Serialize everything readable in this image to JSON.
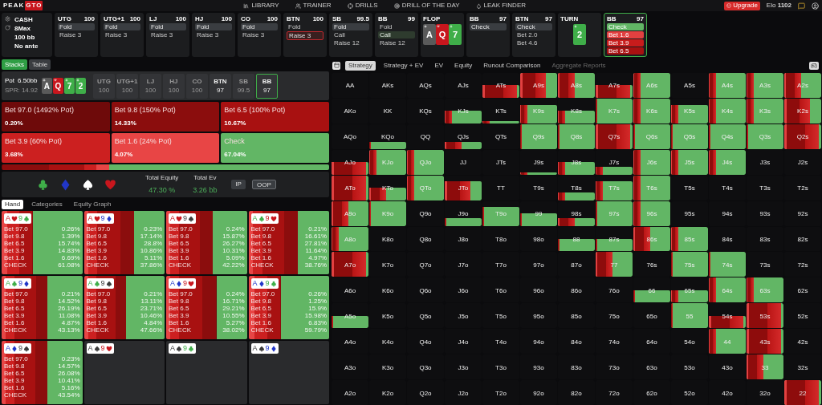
{
  "header": {
    "logo": {
      "part_1": "PEAK",
      "part_2": "GTO"
    },
    "nav": [
      {
        "label": "LIBRARY",
        "kind": "library"
      },
      {
        "label": "TRAINER",
        "kind": "trainer"
      },
      {
        "label": "DRILLS",
        "kind": "drills"
      },
      {
        "label": "DRILL OF THE DAY",
        "kind": "daily"
      },
      {
        "label": "LEAK FINDER",
        "kind": "leak"
      }
    ],
    "upgrade": "Upgrade",
    "elo_label": "Elo",
    "elo": "1102"
  },
  "settings": [
    "CASH",
    "8Max",
    "100 bb",
    "No ante"
  ],
  "nodes": [
    {
      "kind": "seat",
      "position": "UTG",
      "stack": "100",
      "active": false,
      "options": [
        {
          "label": "Fold",
          "kind": "fold",
          "selected": true
        },
        {
          "label": "Raise 3",
          "selected": false
        }
      ]
    },
    {
      "kind": "seat",
      "position": "UTG+1",
      "stack": "100",
      "active": false,
      "options": [
        {
          "label": "Fold",
          "kind": "fold",
          "selected": true
        },
        {
          "label": "Raise 3",
          "selected": false
        }
      ]
    },
    {
      "kind": "seat",
      "position": "LJ",
      "stack": "100",
      "active": false,
      "options": [
        {
          "label": "Fold",
          "kind": "fold",
          "selected": true
        },
        {
          "label": "Raise 3",
          "selected": false
        }
      ]
    },
    {
      "kind": "seat",
      "position": "HJ",
      "stack": "100",
      "active": false,
      "options": [
        {
          "label": "Fold",
          "kind": "fold",
          "selected": true
        },
        {
          "label": "Raise 3",
          "selected": false
        }
      ]
    },
    {
      "kind": "seat",
      "position": "CO",
      "stack": "100",
      "active": false,
      "options": [
        {
          "label": "Fold",
          "kind": "fold",
          "selected": true
        },
        {
          "label": "Raise 3",
          "selected": false
        }
      ]
    },
    {
      "kind": "seat",
      "position": "BTN",
      "stack": "100",
      "active": false,
      "options": [
        {
          "label": "Fold",
          "selected": false
        },
        {
          "label": "Raise 3",
          "kind": "raise",
          "selected": true
        }
      ]
    },
    {
      "kind": "seat",
      "position": "SB",
      "stack": "99.5",
      "active": false,
      "options": [
        {
          "label": "Fold",
          "kind": "fold",
          "selected": true
        },
        {
          "label": "Call",
          "selected": false
        },
        {
          "label": "Raise 12",
          "selected": false
        }
      ]
    },
    {
      "kind": "seat",
      "position": "BB",
      "stack": "99",
      "active": false,
      "options": [
        {
          "label": "Fold",
          "selected": false
        },
        {
          "label": "Call",
          "kind": "call",
          "selected": true
        },
        {
          "label": "Raise 12",
          "selected": false
        }
      ]
    },
    {
      "kind": "board",
      "street": "FLOP",
      "cards": [
        {
          "rank": "A",
          "kind": "spades"
        },
        {
          "rank": "Q",
          "kind": "hearts"
        },
        {
          "rank": "7",
          "kind": "clubs"
        }
      ]
    },
    {
      "kind": "seat",
      "position": "BB",
      "stack": "97",
      "active": false,
      "options": [
        {
          "label": "Check",
          "kind": "check",
          "selected": true
        }
      ]
    },
    {
      "kind": "seat",
      "position": "BTN",
      "stack": "97",
      "active": false,
      "options": [
        {
          "label": "Check",
          "kind": "check",
          "selected": true
        },
        {
          "label": "Bet 2.0",
          "selected": false
        },
        {
          "label": "Bet 4.6",
          "selected": false
        }
      ]
    },
    {
      "kind": "board",
      "street": "TURN",
      "cards": [
        {
          "rank": "2",
          "kind": "clubs"
        }
      ]
    },
    {
      "kind": "seat",
      "position": "BB",
      "stack": "97",
      "active": true,
      "options": [
        {
          "label": "Check",
          "color": "#62b665"
        },
        {
          "label": "Bet 1.6",
          "color": "#e24040"
        },
        {
          "label": "Bet 3.9",
          "color": "#c81c1c"
        },
        {
          "label": "Bet 6.5",
          "color": "#a81111"
        }
      ]
    }
  ],
  "view_tabs": [
    {
      "label": "Stacks",
      "selected": true
    },
    {
      "label": "Table",
      "selected": false
    }
  ],
  "pot": {
    "label": "Pot",
    "value": "6.50bb",
    "spr": "SPR: 14.92",
    "board": [
      {
        "rank": "A",
        "kind": "spades"
      },
      {
        "rank": "Q",
        "kind": "hearts"
      },
      {
        "rank": "7",
        "kind": "clubs"
      },
      {
        "rank": "2",
        "kind": "clubs"
      }
    ],
    "seats": [
      {
        "position": "UTG",
        "stack": "100",
        "folded": true,
        "selected": false
      },
      {
        "position": "UTG+1",
        "stack": "100",
        "folded": true,
        "selected": false
      },
      {
        "position": "LJ",
        "stack": "100",
        "folded": true,
        "selected": false
      },
      {
        "position": "HJ",
        "stack": "100",
        "folded": true,
        "selected": false
      },
      {
        "position": "CO",
        "stack": "100",
        "folded": true,
        "selected": false
      },
      {
        "position": "BTN",
        "stack": "97",
        "folded": false,
        "selected": false
      },
      {
        "position": "SB",
        "stack": "99.5",
        "folded": true,
        "selected": false
      },
      {
        "position": "BB",
        "stack": "97",
        "folded": false,
        "selected": true
      }
    ]
  },
  "actions": [
    {
      "label": "Bet 97.0 (1492% Pot)",
      "frequency": "0.20%",
      "color": "#6e0a0a"
    },
    {
      "label": "Bet 9.8 (150% Pot)",
      "frequency": "14.33%",
      "color": "#8b0d0d"
    },
    {
      "label": "Bet 6.5 (100% Pot)",
      "frequency": "10.67%",
      "color": "#a81111"
    },
    {
      "label": "Bet 3.9 (60% Pot)",
      "frequency": "3.68%",
      "color": "#cc2020"
    },
    {
      "label": "Bet 1.6 (24% Pot)",
      "frequency": "4.07%",
      "color": "#e84545"
    },
    {
      "label": "Check",
      "frequency": "67.04%",
      "color": "#62b665"
    }
  ],
  "suit_filters": [
    {
      "kind": "clubs"
    },
    {
      "kind": "diamonds"
    },
    {
      "kind": "spades"
    },
    {
      "kind": "hearts"
    }
  ],
  "totals": [
    {
      "label": "Total Equity",
      "value": "47.30 %"
    },
    {
      "label": "Total Ev",
      "value": "3.26 bb"
    }
  ],
  "player_buttons": [
    {
      "label": "IP",
      "selected": false
    },
    {
      "label": "OOP",
      "selected": true
    }
  ],
  "hand_tabs": [
    {
      "label": "Hand",
      "selected": true
    },
    {
      "label": "Categories",
      "selected": false
    },
    {
      "label": "Equity Graph",
      "selected": false
    }
  ],
  "hands": [
    {
      "cards": [
        {
          "rank": "A",
          "kind": "hearts"
        },
        {
          "rank": "9",
          "kind": "clubs"
        }
      ],
      "rows": [
        {
          "label": "Bet 97.0",
          "value": "0.26%"
        },
        {
          "label": "Bet 9.8",
          "value": "1.39%"
        },
        {
          "label": "Bet 6.5",
          "value": "15.74%"
        },
        {
          "label": "Bet 3.9",
          "value": "14.83%"
        },
        {
          "label": "Bet 1.6",
          "value": "6.69%"
        },
        {
          "label": "CHECK",
          "value": "61.08%"
        }
      ]
    },
    {
      "cards": [
        {
          "rank": "A",
          "kind": "hearts"
        },
        {
          "rank": "9",
          "kind": "diamonds"
        }
      ],
      "rows": [
        {
          "label": "Bet 97.0",
          "value": "0.23%"
        },
        {
          "label": "Bet 9.8",
          "value": "17.14%"
        },
        {
          "label": "Bet 6.5",
          "value": "28.8%"
        },
        {
          "label": "Bet 3.9",
          "value": "10.86%"
        },
        {
          "label": "Bet 1.6",
          "value": "5.11%"
        },
        {
          "label": "CHECK",
          "value": "37.86%"
        }
      ]
    },
    {
      "cards": [
        {
          "rank": "A",
          "kind": "hearts"
        },
        {
          "rank": "9",
          "kind": "spades"
        }
      ],
      "rows": [
        {
          "label": "Bet 97.0",
          "value": "0.24%"
        },
        {
          "label": "Bet 9.8",
          "value": "15.87%"
        },
        {
          "label": "Bet 6.5",
          "value": "26.27%"
        },
        {
          "label": "Bet 3.9",
          "value": "10.31%"
        },
        {
          "label": "Bet 1.6",
          "value": "5.09%"
        },
        {
          "label": "CHECK",
          "value": "42.22%"
        }
      ]
    },
    {
      "cards": [
        {
          "rank": "A",
          "kind": "clubs"
        },
        {
          "rank": "9",
          "kind": "hearts"
        }
      ],
      "rows": [
        {
          "label": "Bet 97.0",
          "value": "0.21%"
        },
        {
          "label": "Bet 9.8",
          "value": "16.61%"
        },
        {
          "label": "Bet 6.5",
          "value": "27.81%"
        },
        {
          "label": "Bet 3.9",
          "value": "11.64%"
        },
        {
          "label": "Bet 1.6",
          "value": "4.97%"
        },
        {
          "label": "CHECK",
          "value": "38.76%"
        }
      ]
    },
    {
      "cards": [
        {
          "rank": "A",
          "kind": "clubs"
        },
        {
          "rank": "9",
          "kind": "diamonds"
        }
      ],
      "rows": [
        {
          "label": "Bet 97.0",
          "value": "0.21%"
        },
        {
          "label": "Bet 9.8",
          "value": "14.52%"
        },
        {
          "label": "Bet 6.5",
          "value": "26.19%"
        },
        {
          "label": "Bet 3.9",
          "value": "11.08%"
        },
        {
          "label": "Bet 1.6",
          "value": "4.87%"
        },
        {
          "label": "CHECK",
          "value": "43.13%"
        }
      ]
    },
    {
      "cards": [
        {
          "rank": "A",
          "kind": "clubs"
        },
        {
          "rank": "9",
          "kind": "spades"
        }
      ],
      "rows": [
        {
          "label": "Bet 97.0",
          "value": "0.21%"
        },
        {
          "label": "Bet 9.8",
          "value": "13.11%"
        },
        {
          "label": "Bet 6.5",
          "value": "23.71%"
        },
        {
          "label": "Bet 3.9",
          "value": "10.46%"
        },
        {
          "label": "Bet 1.6",
          "value": "4.84%"
        },
        {
          "label": "CHECK",
          "value": "47.66%"
        }
      ]
    },
    {
      "cards": [
        {
          "rank": "A",
          "kind": "diamonds"
        },
        {
          "rank": "9",
          "kind": "hearts"
        }
      ],
      "rows": [
        {
          "label": "Bet 97.0",
          "value": "0.24%"
        },
        {
          "label": "Bet 9.8",
          "value": "16.71%"
        },
        {
          "label": "Bet 6.5",
          "value": "29.21%"
        },
        {
          "label": "Bet 3.9",
          "value": "10.55%"
        },
        {
          "label": "Bet 1.6",
          "value": "5.27%"
        },
        {
          "label": "CHECK",
          "value": "38.02%"
        }
      ]
    },
    {
      "cards": [
        {
          "rank": "A",
          "kind": "diamonds"
        },
        {
          "rank": "9",
          "kind": "clubs"
        }
      ],
      "rows": [
        {
          "label": "Bet 97.0",
          "value": "0.26%"
        },
        {
          "label": "Bet 9.8",
          "value": "1.25%"
        },
        {
          "label": "Bet 6.5",
          "value": "15.9%"
        },
        {
          "label": "Bet 3.9",
          "value": "15.98%"
        },
        {
          "label": "Bet 1.6",
          "value": "6.83%"
        },
        {
          "label": "CHECK",
          "value": "59.79%"
        }
      ]
    },
    {
      "cards": [
        {
          "rank": "A",
          "kind": "diamonds"
        },
        {
          "rank": "9",
          "kind": "spades"
        }
      ],
      "rows": [
        {
          "label": "Bet 97.0",
          "value": "0.23%"
        },
        {
          "label": "Bet 9.8",
          "value": "14.57%"
        },
        {
          "label": "Bet 6.5",
          "value": "26.08%"
        },
        {
          "label": "Bet 3.9",
          "value": "10.41%"
        },
        {
          "label": "Bet 1.6",
          "value": "5.16%"
        },
        {
          "label": "CHECK",
          "value": "43.54%"
        }
      ]
    },
    {
      "cards": [
        {
          "rank": "A",
          "kind": "spades"
        },
        {
          "rank": "9",
          "kind": "hearts"
        }
      ]
    },
    {
      "cards": [
        {
          "rank": "A",
          "kind": "spades"
        },
        {
          "rank": "9",
          "kind": "clubs"
        }
      ]
    },
    {
      "cards": [
        {
          "rank": "A",
          "kind": "spades"
        },
        {
          "rank": "9",
          "kind": "diamonds"
        }
      ]
    }
  ],
  "matrix_tabs": [
    {
      "label": "Strategy",
      "selected": true,
      "disabled": false
    },
    {
      "label": "Strategy + EV",
      "selected": false,
      "disabled": false
    },
    {
      "label": "EV",
      "selected": false,
      "disabled": false
    },
    {
      "label": "Equity",
      "selected": false,
      "disabled": false
    },
    {
      "label": "Runout Comparison",
      "selected": false,
      "disabled": false
    },
    {
      "label": "Aggregate Reports",
      "selected": false,
      "disabled": true
    }
  ],
  "matrix": {
    "rows": [
      {
        "cells": [
          {
            "label": "AA"
          },
          {
            "label": "AKs"
          },
          {
            "label": "AQs"
          },
          {
            "label": "AJs"
          },
          {
            "label": "ATs",
            "kind": "half-red"
          },
          {
            "label": "A9s",
            "kind": "full-heavy"
          },
          {
            "label": "A8s",
            "kind": "full-mixed"
          },
          {
            "label": "A7s",
            "kind": "half-red"
          },
          {
            "label": "A6s",
            "kind": "full-light"
          },
          {
            "label": "A5s"
          },
          {
            "label": "A4s",
            "kind": "full-light"
          },
          {
            "label": "A3s",
            "kind": "full-light"
          },
          {
            "label": "A2s",
            "kind": "full-mixed"
          }
        ]
      },
      {
        "cells": [
          {
            "label": "AKo"
          },
          {
            "label": "KK"
          },
          {
            "label": "KQs"
          },
          {
            "label": "KJs",
            "kind": "half-light"
          },
          {
            "label": "KTs",
            "kind": "thin-light"
          },
          {
            "label": "K9s",
            "kind": "tall-light"
          },
          {
            "label": "K8s",
            "kind": "half-light"
          },
          {
            "label": "K7s",
            "kind": "full-green"
          },
          {
            "label": "K6s",
            "kind": "full-light"
          },
          {
            "label": "K5s",
            "kind": "tall-light"
          },
          {
            "label": "K4s",
            "kind": "full-light"
          },
          {
            "label": "K3s",
            "kind": "full-light"
          },
          {
            "label": "K2s",
            "kind": "full-heavy"
          }
        ]
      },
      {
        "cells": [
          {
            "label": "AQo"
          },
          {
            "label": "KQo",
            "kind": "low-green"
          },
          {
            "label": "QQ"
          },
          {
            "label": "QJs",
            "kind": "low-mixed"
          },
          {
            "label": "QTs"
          },
          {
            "label": "Q9s",
            "kind": "full-green"
          },
          {
            "label": "Q8s",
            "kind": "full-green"
          },
          {
            "label": "Q7s",
            "kind": "full-red"
          },
          {
            "label": "Q6s",
            "kind": "full-green"
          },
          {
            "label": "Q5s",
            "kind": "full-green"
          },
          {
            "label": "Q4s",
            "kind": "full-green"
          },
          {
            "label": "Q3s",
            "kind": "full-green"
          },
          {
            "label": "Q2s",
            "kind": "full-red"
          }
        ]
      },
      {
        "cells": [
          {
            "label": "AJo",
            "kind": "half-red"
          },
          {
            "label": "KJo",
            "kind": "full-light"
          },
          {
            "label": "QJo",
            "kind": "full-light"
          },
          {
            "label": "JJ"
          },
          {
            "label": "JTs"
          },
          {
            "label": "J9s",
            "kind": "thin-light"
          },
          {
            "label": "J8s",
            "kind": "half-light"
          },
          {
            "label": "J7s",
            "kind": "low-light"
          },
          {
            "label": "J6s",
            "kind": "full-light"
          },
          {
            "label": "J5s",
            "kind": "full-light"
          },
          {
            "label": "J4s",
            "kind": "full-light"
          },
          {
            "label": "J3s"
          },
          {
            "label": "J2s"
          }
        ]
      },
      {
        "cells": [
          {
            "label": "ATo",
            "kind": "full-red"
          },
          {
            "label": "KTo",
            "kind": "half-mixed"
          },
          {
            "label": "QTo",
            "kind": "full-light"
          },
          {
            "label": "JTo",
            "kind": "tall-heavy"
          },
          {
            "label": "TT"
          },
          {
            "label": "T9s"
          },
          {
            "label": "T8s",
            "kind": "low-light"
          },
          {
            "label": "T7s",
            "kind": "tall-light"
          },
          {
            "label": "T6s",
            "kind": "full-light"
          },
          {
            "label": "T5s"
          },
          {
            "label": "T4s"
          },
          {
            "label": "T3s"
          },
          {
            "label": "T2s"
          }
        ]
      },
      {
        "cells": [
          {
            "label": "A9o",
            "kind": "full-mixed"
          },
          {
            "label": "K9o",
            "kind": "full-green"
          },
          {
            "label": "Q9o"
          },
          {
            "label": "J9o",
            "kind": "low-green"
          },
          {
            "label": "T9o",
            "kind": "tall-green"
          },
          {
            "label": "99",
            "kind": "half-green"
          },
          {
            "label": "98s",
            "kind": "low-mixed"
          },
          {
            "label": "97s",
            "kind": "full-green"
          },
          {
            "label": "96s",
            "kind": "full-light"
          },
          {
            "label": "95s"
          },
          {
            "label": "94s"
          },
          {
            "label": "93s"
          },
          {
            "label": "92s"
          }
        ]
      },
      {
        "cells": [
          {
            "label": "A8o",
            "kind": "full-light"
          },
          {
            "label": "K8o"
          },
          {
            "label": "Q8o"
          },
          {
            "label": "J8o"
          },
          {
            "label": "T8o"
          },
          {
            "label": "98o"
          },
          {
            "label": "88",
            "kind": "half-green"
          },
          {
            "label": "87s",
            "kind": "half-green"
          },
          {
            "label": "86s",
            "kind": "full-mixed"
          },
          {
            "label": "85s",
            "kind": "full-light"
          },
          {
            "label": "84s"
          },
          {
            "label": "83s"
          },
          {
            "label": "82s"
          }
        ]
      },
      {
        "cells": [
          {
            "label": "A7o",
            "kind": "full-red"
          },
          {
            "label": "K7o"
          },
          {
            "label": "Q7o"
          },
          {
            "label": "J7o"
          },
          {
            "label": "T7o"
          },
          {
            "label": "97o"
          },
          {
            "label": "87o"
          },
          {
            "label": "77",
            "kind": "full-mixed"
          },
          {
            "label": "76s"
          },
          {
            "label": "75s",
            "kind": "full-green"
          },
          {
            "label": "74s",
            "kind": "full-green"
          },
          {
            "label": "73s"
          },
          {
            "label": "72s"
          }
        ]
      },
      {
        "cells": [
          {
            "label": "A6o"
          },
          {
            "label": "K6o"
          },
          {
            "label": "Q6o"
          },
          {
            "label": "J6o"
          },
          {
            "label": "T6o"
          },
          {
            "label": "96o"
          },
          {
            "label": "86o"
          },
          {
            "label": "76o"
          },
          {
            "label": "66",
            "kind": "half-green"
          },
          {
            "label": "65s",
            "kind": "half-light"
          },
          {
            "label": "64s",
            "kind": "full-light"
          },
          {
            "label": "63s",
            "kind": "full-light"
          },
          {
            "label": "62s"
          }
        ]
      },
      {
        "cells": [
          {
            "label": "A5o",
            "kind": "half-green"
          },
          {
            "label": "K5o"
          },
          {
            "label": "Q5o"
          },
          {
            "label": "J5o"
          },
          {
            "label": "T5o"
          },
          {
            "label": "95o"
          },
          {
            "label": "85o"
          },
          {
            "label": "75o"
          },
          {
            "label": "65o"
          },
          {
            "label": "55",
            "kind": "full-green"
          },
          {
            "label": "54s",
            "kind": "half-red"
          },
          {
            "label": "53s",
            "kind": "full-red"
          },
          {
            "label": "52s"
          }
        ]
      },
      {
        "cells": [
          {
            "label": "A4o"
          },
          {
            "label": "K4o"
          },
          {
            "label": "Q4o"
          },
          {
            "label": "J4o"
          },
          {
            "label": "T4o"
          },
          {
            "label": "94o"
          },
          {
            "label": "84o"
          },
          {
            "label": "74o"
          },
          {
            "label": "64o"
          },
          {
            "label": "54o"
          },
          {
            "label": "44",
            "kind": "full-light"
          },
          {
            "label": "43s",
            "kind": "full-red"
          },
          {
            "label": "42s"
          }
        ]
      },
      {
        "cells": [
          {
            "label": "A3o"
          },
          {
            "label": "K3o"
          },
          {
            "label": "Q3o"
          },
          {
            "label": "J3o"
          },
          {
            "label": "T3o"
          },
          {
            "label": "93o"
          },
          {
            "label": "83o"
          },
          {
            "label": "73o"
          },
          {
            "label": "63o"
          },
          {
            "label": "53o"
          },
          {
            "label": "43o"
          },
          {
            "label": "33",
            "kind": "full-mixed"
          },
          {
            "label": "32s"
          }
        ]
      },
      {
        "cells": [
          {
            "label": "A2o"
          },
          {
            "label": "K2o"
          },
          {
            "label": "Q2o"
          },
          {
            "label": "J2o"
          },
          {
            "label": "T2o"
          },
          {
            "label": "92o"
          },
          {
            "label": "82o"
          },
          {
            "label": "72o"
          },
          {
            "label": "62o"
          },
          {
            "label": "52o"
          },
          {
            "label": "42o"
          },
          {
            "label": "32o"
          },
          {
            "label": "22",
            "kind": "full-red"
          }
        ]
      }
    ]
  }
}
